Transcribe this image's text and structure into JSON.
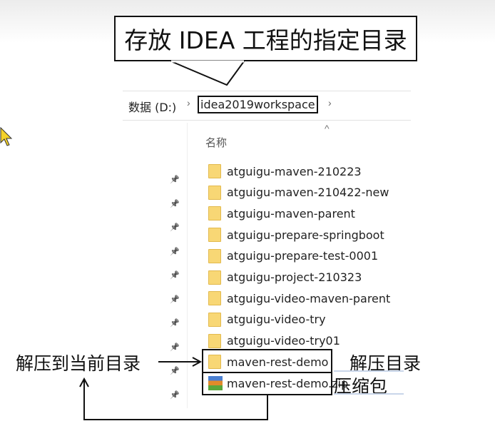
{
  "annotations": {
    "workspace_callout": "存放 IDEA 工程的指定目录",
    "extract_here": "解压到当前目录",
    "extract_dir": "解压目录",
    "archive": "压缩包"
  },
  "breadcrumb": {
    "drive": "数据 (D:)",
    "folder": "idea2019workspace"
  },
  "file_list": {
    "column_name": "名称",
    "items": [
      {
        "name": "atguigu-maven-210223",
        "type": "folder"
      },
      {
        "name": "atguigu-maven-210422-new",
        "type": "folder"
      },
      {
        "name": "atguigu-maven-parent",
        "type": "folder"
      },
      {
        "name": "atguigu-prepare-springboot",
        "type": "folder"
      },
      {
        "name": "atguigu-prepare-test-0001",
        "type": "folder"
      },
      {
        "name": "atguigu-project-210323",
        "type": "folder"
      },
      {
        "name": "atguigu-video-maven-parent",
        "type": "folder"
      },
      {
        "name": "atguigu-video-try",
        "type": "folder"
      },
      {
        "name": "atguigu-video-try01",
        "type": "folder"
      },
      {
        "name": "maven-rest-demo",
        "type": "folder"
      },
      {
        "name": "maven-rest-demo.zip",
        "type": "zip"
      }
    ]
  }
}
